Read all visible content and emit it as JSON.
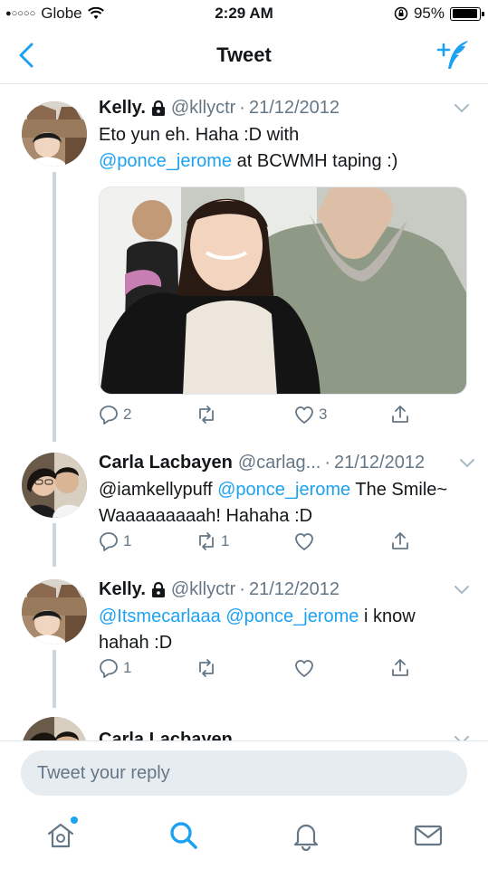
{
  "status_bar": {
    "signal": "●○○○○",
    "carrier": "Globe",
    "time": "2:29 AM",
    "battery_percent": "95%",
    "battery_level": 0.95
  },
  "nav": {
    "title": "Tweet"
  },
  "colors": {
    "accent": "#1da1f2",
    "secondary_text": "#657786",
    "thread_line": "#ccd6dd"
  },
  "tweets": [
    {
      "name": "Kelly.",
      "protected": true,
      "handle": "@kllyctr",
      "separator": "·",
      "date": "21/12/2012",
      "text_parts": [
        "Eto yun eh. Haha :D with",
        "@ponce_jerome",
        "at BCWMH taping :)"
      ],
      "replies": "2",
      "retweets": "",
      "likes": "3"
    },
    {
      "name": "Carla Lacbayen",
      "protected": false,
      "handle": "@carlag...",
      "separator": "·",
      "date": "21/12/2012",
      "text_parts": [
        "@iamkellypuff",
        "@ponce_jerome",
        "The Smile~ Waaaaaaaaah! Hahaha :D"
      ],
      "replies": "1",
      "retweets": "1",
      "likes": ""
    },
    {
      "name": "Kelly.",
      "protected": true,
      "handle": "@kllyctr",
      "separator": "·",
      "date": "21/12/2012",
      "text_parts": [
        "@Itsmecarlaaa",
        "@ponce_jerome",
        "i know hahah :D"
      ],
      "replies": "1",
      "retweets": "",
      "likes": ""
    },
    {
      "name": "Carla Lacbayen"
    }
  ],
  "reply": {
    "placeholder": "Tweet your reply"
  },
  "tabbar": {
    "icons": [
      "home-icon",
      "search-icon",
      "notifications-icon",
      "messages-icon"
    ]
  }
}
